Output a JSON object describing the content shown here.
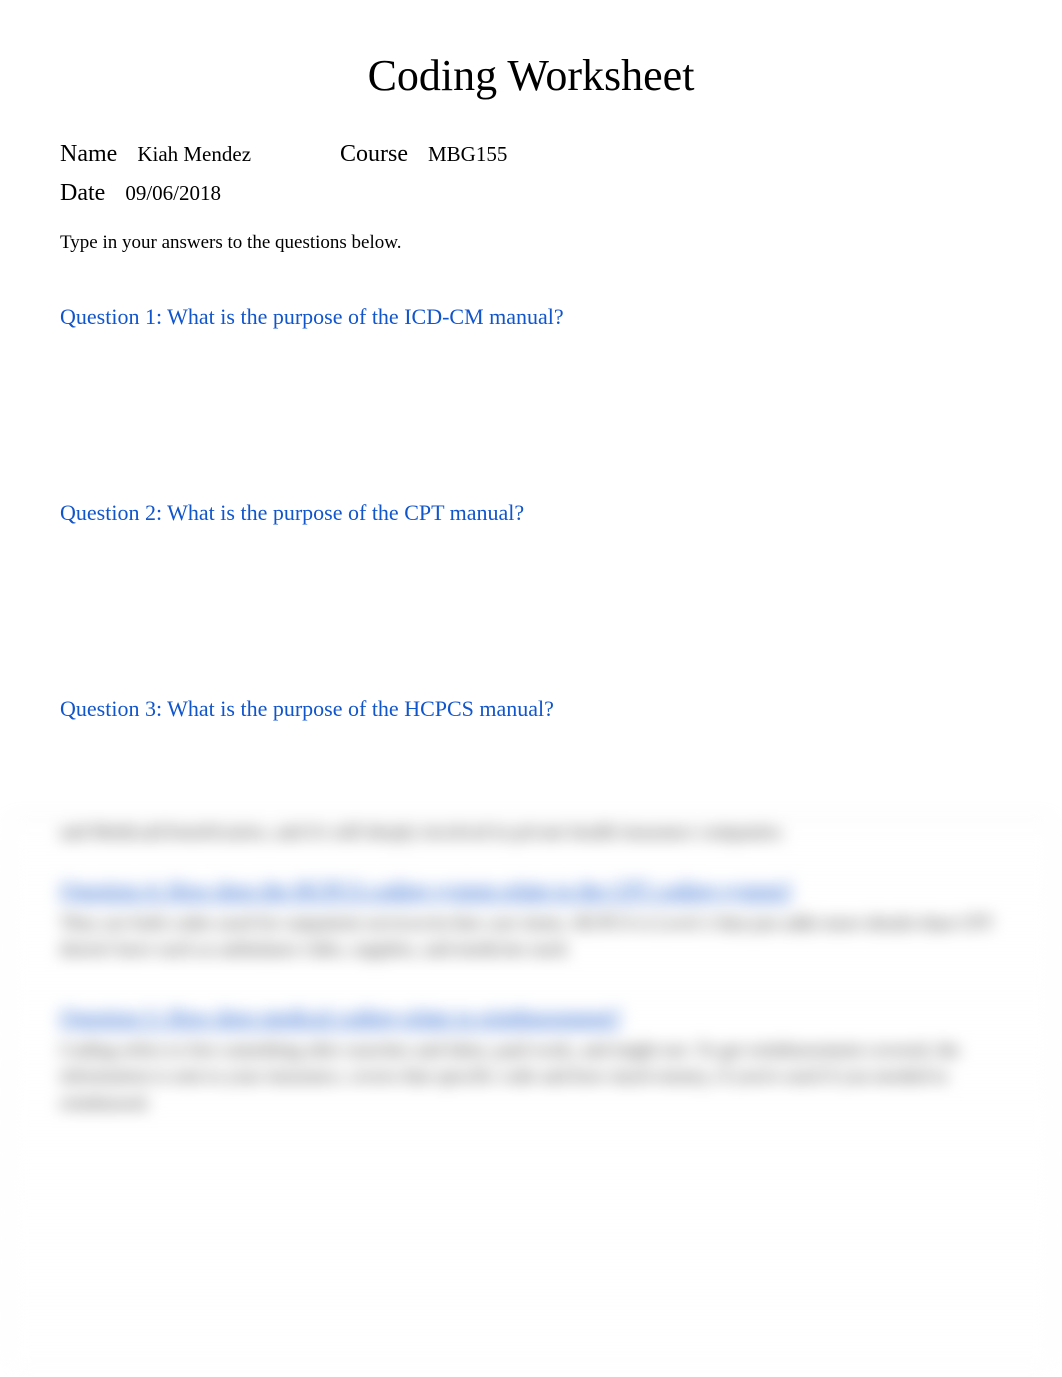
{
  "title": "Coding Worksheet",
  "header": {
    "name_label": "Name",
    "name_value": "Kiah Mendez",
    "course_label": "Course",
    "course_value": "MBG155",
    "date_label": "Date",
    "date_value": "09/06/2018"
  },
  "instruction": "Type in your answers to the questions below.",
  "questions": {
    "q1": "Question 1: What is the purpose of the ICD-CM manual?",
    "q2": "Question 2: What is the purpose of the CPT manual?",
    "q3": "Question 3: What is the purpose of the HCPCS manual?"
  },
  "blurred": {
    "text1": "and Medicaid beneficiaries, and it's still deeply involved in private health insurance companies.",
    "q4": "Question 4: How does the HCPCS coding system relate to the CPT coding system?",
    "a4": "They are both codes used for outpatient services/in-line care items. HCPCS is Level 2 that just adds more details than CPT doesn't have such as ambulance rides, supplies, and medicine used.",
    "q5": "Question 5: How does medical coding relate to reimbursement?",
    "a5": "Coding refers to free something after searches and labor, paid work, and might not. To get reimbursement covered, the information is sent to your insurance, covers that specific code and how much money, if you're used if you needed to reimbursed."
  }
}
